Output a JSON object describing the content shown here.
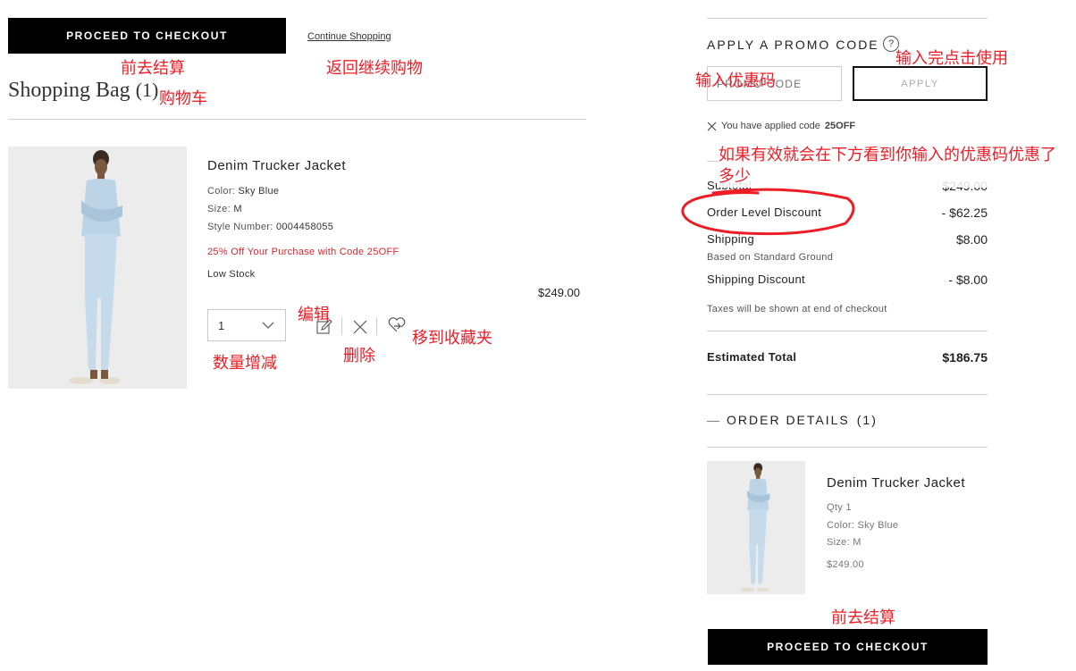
{
  "top": {
    "checkout_label": "PROCEED TO CHECKOUT",
    "continue_label": "Continue Shopping",
    "bag_title": "Shopping Bag",
    "bag_count": "(1)"
  },
  "item": {
    "name": "Denim Trucker Jacket",
    "color_label": "Color:",
    "color_value": "Sky Blue",
    "size_label": "Size:",
    "size_value": "M",
    "style_label": "Style Number:",
    "style_value": "0004458055",
    "promo_text": "25% Off Your Purchase with Code 25OFF",
    "stock_text": "Low Stock",
    "price": "$249.00",
    "qty": "1"
  },
  "promo": {
    "heading": "APPLY A PROMO CODE",
    "help_icon_char": "?",
    "placeholder": "PROMO CODE",
    "apply_label": "APPLY",
    "applied_prefix": "You have applied code",
    "applied_code": "25OFF"
  },
  "summary": {
    "subtotal_label": "Subtotal",
    "subtotal_value": "$249.00",
    "order_discount_label": "Order Level Discount",
    "order_discount_value": "- $62.25",
    "shipping_label": "Shipping",
    "shipping_value": "$8.00",
    "shipping_sub": "Based on Standard Ground",
    "shipping_discount_label": "Shipping Discount",
    "shipping_discount_value": "- $8.00",
    "tax_note": "Taxes will be shown at end of checkout",
    "total_label": "Estimated Total",
    "total_value": "$186.75"
  },
  "order_details": {
    "toggle_char": "—",
    "heading": "ORDER DETAILS",
    "count": "(1)",
    "item_name": "Denim Trucker Jacket",
    "qty_text": "Qty 1",
    "color_text": "Color: Sky Blue",
    "size_text": "Size: M",
    "price": "$249.00",
    "checkout_label": "PROCEED TO CHECKOUT"
  },
  "annotations": {
    "checkout_top": "前去结算",
    "continue": "返回继续购物",
    "bag": "购物车",
    "edit": "编辑",
    "quantity": "数量增减",
    "delete": "删除",
    "favorite": "移到收藏夹",
    "enter_code": "输入优惠码",
    "apply_hint": "输入完点击使用",
    "discount_hint": "如果有效就会在下方看到你输入的优惠码优惠了多少",
    "checkout_bottom": "前去结算"
  },
  "colors": {
    "annotation": "#ee1c25",
    "discount": "#d9262c",
    "button": "#000000"
  }
}
